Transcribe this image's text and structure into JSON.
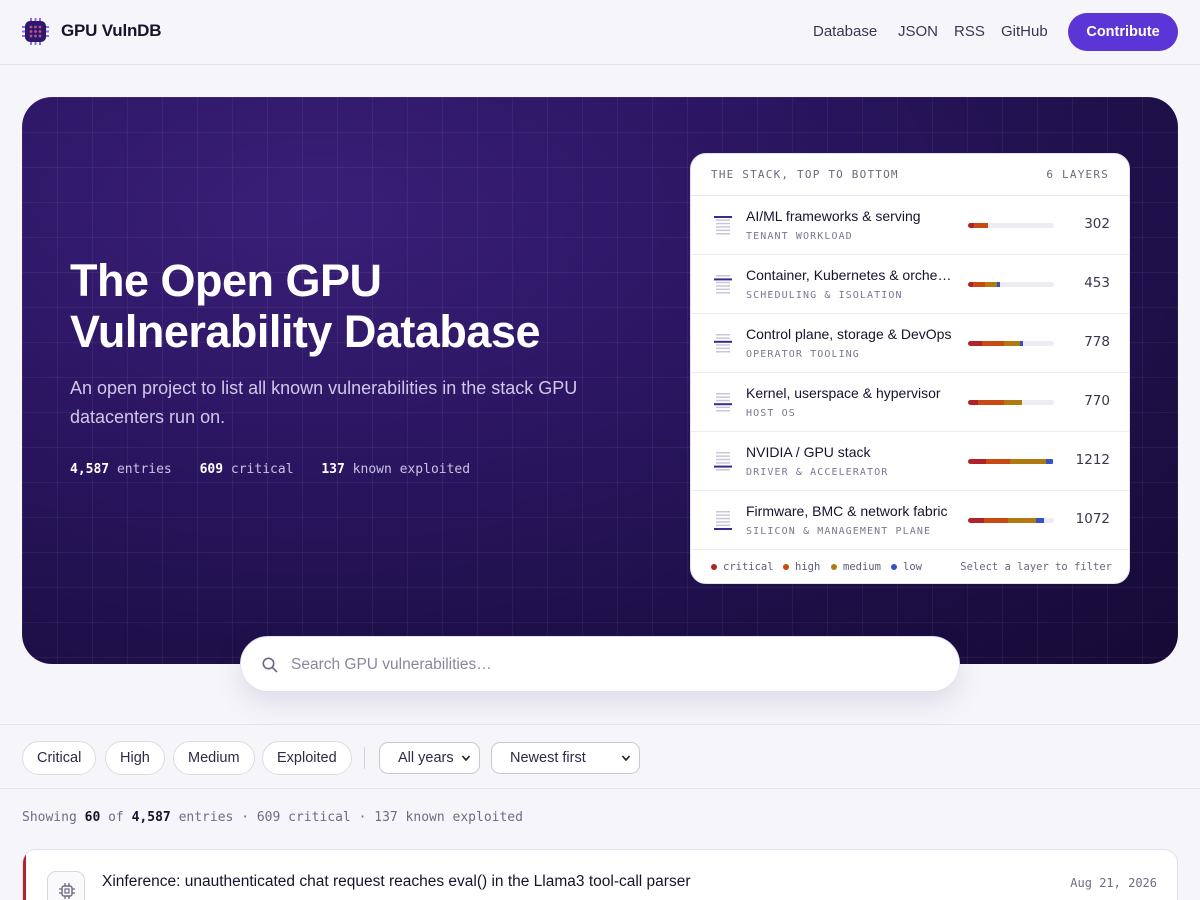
{
  "header": {
    "brand": "GPU VulnDB",
    "nav": [
      "Database",
      "JSON",
      "RSS",
      "GitHub"
    ],
    "contribute_label": "Contribute"
  },
  "hero": {
    "title": "The Open GPU Vulnerability Database",
    "subtitle": "An open project to list all known vulnerabilities in the stack GPU datacenters run on.",
    "stats": {
      "entries_value": "4,587",
      "entries_label": "entries",
      "critical_value": "609",
      "critical_label": "critical",
      "exploited_value": "137",
      "exploited_label": "known exploited"
    }
  },
  "stack": {
    "heading": "THE STACK, TOP TO BOTTOM",
    "layer_count_label": "6 LAYERS",
    "layers": [
      {
        "name": "AI/ML frameworks & serving",
        "sub": "TENANT WORKLOAD",
        "count": "302",
        "level": 1
      },
      {
        "name": "Container, Kubernetes & orchestration",
        "sub": "SCHEDULING & ISOLATION",
        "count": "453",
        "level": 2
      },
      {
        "name": "Control plane, storage & DevOps",
        "sub": "OPERATOR TOOLING",
        "count": "778",
        "level": 3
      },
      {
        "name": "Kernel, userspace & hypervisor",
        "sub": "HOST OS",
        "count": "770",
        "level": 4
      },
      {
        "name": "NVIDIA / GPU stack",
        "sub": "DRIVER & ACCELERATOR",
        "count": "1212",
        "level": 5
      },
      {
        "name": "Firmware, BMC & network fabric",
        "sub": "SILICON & MANAGEMENT PLANE",
        "count": "1072",
        "level": 6
      }
    ],
    "legend": [
      {
        "label": "critical",
        "color": "#b1232b"
      },
      {
        "label": "high",
        "color": "#c84a12"
      },
      {
        "label": "medium",
        "color": "#b07a10"
      },
      {
        "label": "low",
        "color": "#3650c8"
      }
    ],
    "hint": "Select a layer to filter"
  },
  "search": {
    "placeholder": "Search GPU vulnerabilities…"
  },
  "filters": {
    "chips": [
      "Critical",
      "High",
      "Medium",
      "Exploited"
    ],
    "year_select": "All years",
    "sort_select": "Newest first"
  },
  "showing": {
    "prefix": "Showing",
    "shown": "60",
    "of": "of",
    "total": "4,587",
    "entries_label": "entries",
    "rest": "· 609 critical · 137 known exploited"
  },
  "entries": [
    {
      "title": "Xinference: unauthenticated chat request reaches eval() in the Llama3 tool-call parser",
      "date": "Aug 21, 2026"
    }
  ]
}
